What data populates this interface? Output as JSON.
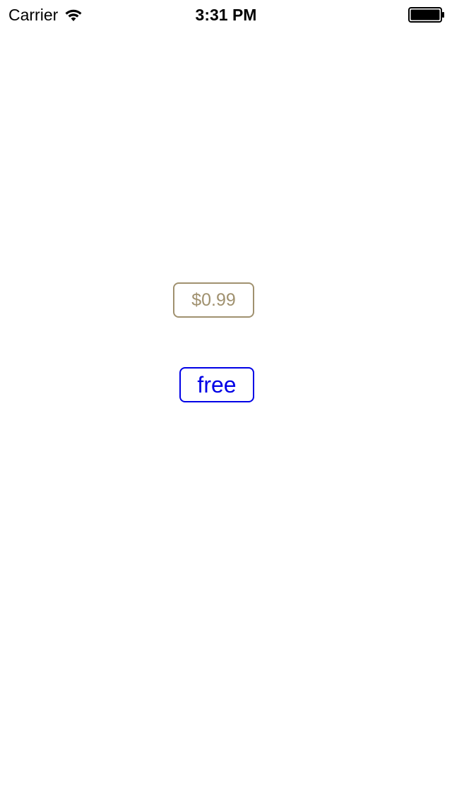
{
  "status_bar": {
    "carrier": "Carrier",
    "time": "3:31 PM",
    "wifi_icon": "wifi-icon",
    "battery_icon": "battery-icon"
  },
  "buttons": {
    "price_label": "$0.99",
    "free_label": "free"
  },
  "colors": {
    "price_accent": "#a0916f",
    "free_accent": "#0000e6",
    "background": "#ffffff"
  }
}
